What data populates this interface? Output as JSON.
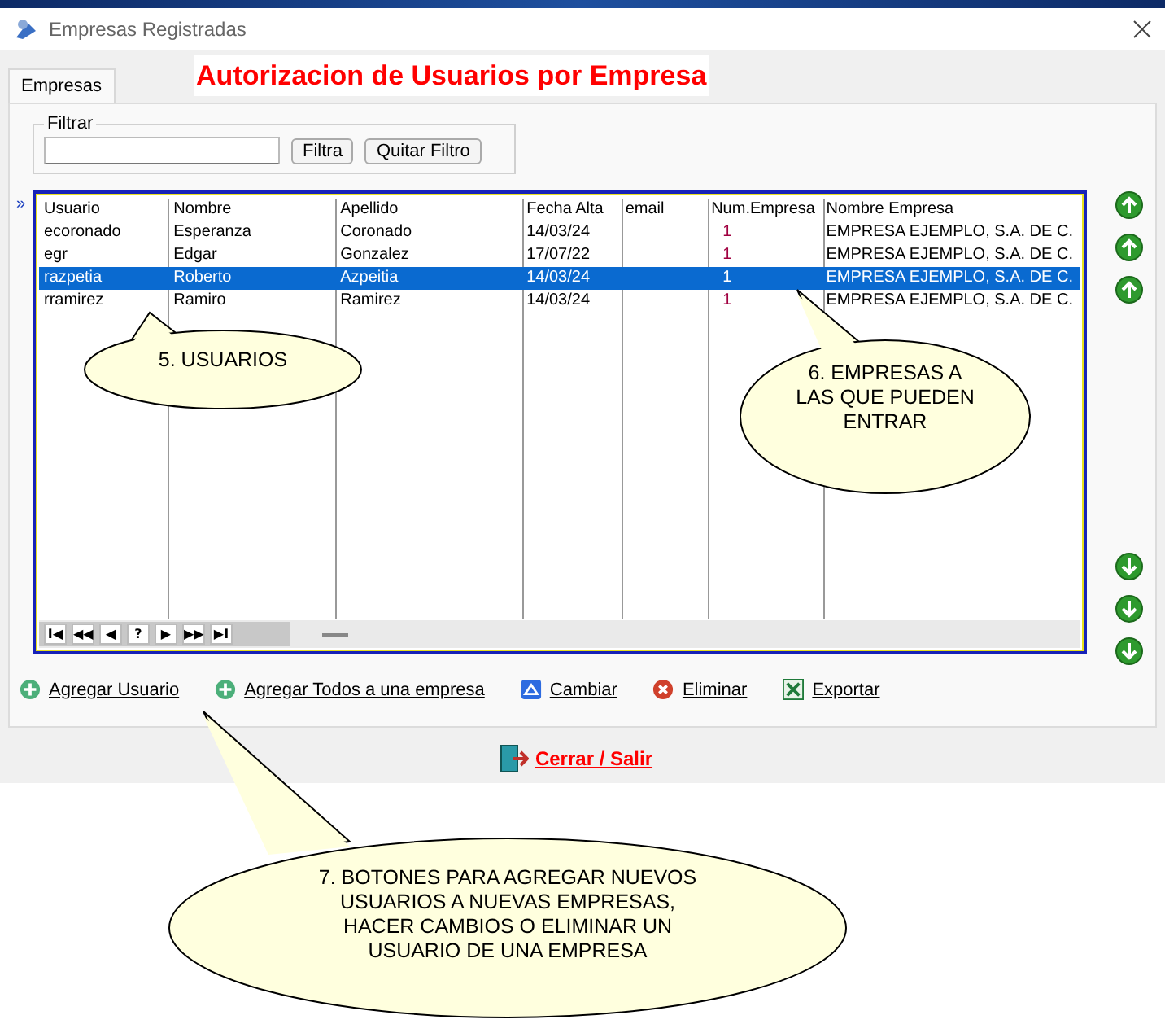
{
  "window": {
    "title": "Empresas Registradas"
  },
  "tabs": [
    {
      "label": "Empresas",
      "selected": true
    }
  ],
  "heading": "Autorizacion de Usuarios por Empresa",
  "filter": {
    "label": "Filtrar",
    "buttons": [
      "Filtra",
      "Quitar Filtro"
    ]
  },
  "table": {
    "columns": [
      "Usuario",
      "Nombre",
      "Apellido",
      "Fecha Alta",
      "email",
      "Num.Empresa",
      "Nombre Empresa"
    ],
    "rows": [
      {
        "cells": [
          "ecoronado",
          "Esperanza",
          "Coronado",
          "14/03/24",
          "",
          "1",
          "EMPRESA EJEMPLO, S.A. DE C."
        ],
        "selected": false
      },
      {
        "cells": [
          "egr",
          "Edgar",
          "Gonzalez",
          "17/07/22",
          "",
          "1",
          "EMPRESA EJEMPLO, S.A. DE C."
        ],
        "selected": false
      },
      {
        "cells": [
          "razpetia",
          "Roberto",
          "Azpeitia",
          "14/03/24",
          "",
          "1",
          "EMPRESA EJEMPLO, S.A. DE C."
        ],
        "selected": true
      },
      {
        "cells": [
          "rramirez",
          "Ramiro",
          "Ramirez",
          "14/03/24",
          "",
          "1",
          "EMPRESA EJEMPLO, S.A. DE C."
        ],
        "selected": false
      }
    ],
    "row_indicator": "»",
    "navigator": [
      "I◀",
      "◀◀",
      "◀",
      "?",
      "▶",
      "▶▶",
      "▶I"
    ]
  },
  "actions": [
    {
      "label": "Agregar Usuario",
      "kind": "add"
    },
    {
      "label": "Agregar Todos a una empresa",
      "kind": "add"
    },
    {
      "label": "Cambiar",
      "kind": "edit"
    },
    {
      "label": "Eliminar",
      "kind": "delete"
    },
    {
      "label": "Exportar",
      "kind": "excel"
    }
  ],
  "close_button": "Cerrar / Salir",
  "callouts": [
    {
      "text": "5. USUARIOS"
    },
    {
      "text": "6. EMPRESAS A LAS QUE PUEDEN ENTRAR"
    },
    {
      "text": "7. BOTONES PARA AGREGAR NUEVOS USUARIOS A NUEVAS EMPRESAS, HACER CAMBIOS O ELIMINAR UN USUARIO DE UNA EMPRESA"
    }
  ]
}
